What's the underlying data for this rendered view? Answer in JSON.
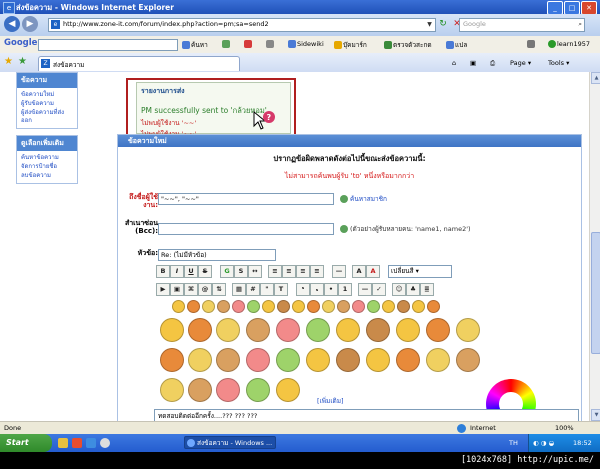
{
  "window": {
    "title": "ส่งข้อความ - Windows Internet Explorer"
  },
  "address": {
    "url": "http://www.zone-it.com/forum/index.php?action=pm;sa=send2",
    "search_placeholder": "Google"
  },
  "gtoolbar": {
    "logo": "Google",
    "items": [
      "ค้นหา",
      "Sidewiki",
      "บุ๊คมาร์ก",
      "ตรวจตัวสะกด",
      "แปล",
      "learn1957"
    ]
  },
  "tab": {
    "label": "ส่งข้อความ"
  },
  "commandbar": {
    "page": "Page",
    "tools": "Tools"
  },
  "sidebar": {
    "sections": [
      {
        "title": "ข้อความ",
        "links": [
          "ข้อความใหม่",
          "ผู้รับข้อความ",
          "ผู้ส่งข้อความที่ส่งออก"
        ]
      },
      {
        "title": "ดูเลือกเพิ่มเติม",
        "links": [
          "ค้นหาข้อความ",
          "จัดการป้ายชื่อ",
          "ลบข้อความ"
        ]
      }
    ]
  },
  "report": {
    "title": "รายงานการส่ง",
    "success": "PM successfully sent to 'กล้วยหอม'.",
    "errors": [
      "ไม่พบผู้ใช้งาน '~~'",
      "ไม่พบผู้ใช้งาน '~~'"
    ]
  },
  "post": {
    "header": "ข้อความใหม่",
    "error_heading": "ปรากฏข้อผิดพลาดดังต่อไปนี้ขณะส่งข้อความนี้:",
    "error_line": "ไม่สามารถค้นพบผู้รับ 'to' หนึ่งหรือมากกว่า",
    "to_label": "ถึงชื่อผู้ใช้งาน:",
    "to_value": "\"~~\", \"~~\"",
    "to_hint": "ค้นหาสมาชิก",
    "bcc_label": "สำเนาซ่อน (Bcc):",
    "bcc_hint": "(ตัวอย่างผู้รับหลายคน: 'name1, name2')",
    "subject_label": "หัวข้อ:",
    "subject_value": "Re: (ไม่มีหัวข้อ)",
    "size_select": "เปลี่ยนสี",
    "more_smileys": "[เพิ่มเติม]",
    "message": "ทดสอบติดต่ออีกครั้ง....???  ???   ???"
  },
  "status": {
    "left": "Done",
    "zone": "Internet",
    "zoom": "100%"
  },
  "taskbar": {
    "start": "Start",
    "task": "ส่งข้อความ - Windows ...",
    "lang": "TH",
    "clock": "18:52"
  },
  "watermark": "[1024x768] http://upic.me/"
}
